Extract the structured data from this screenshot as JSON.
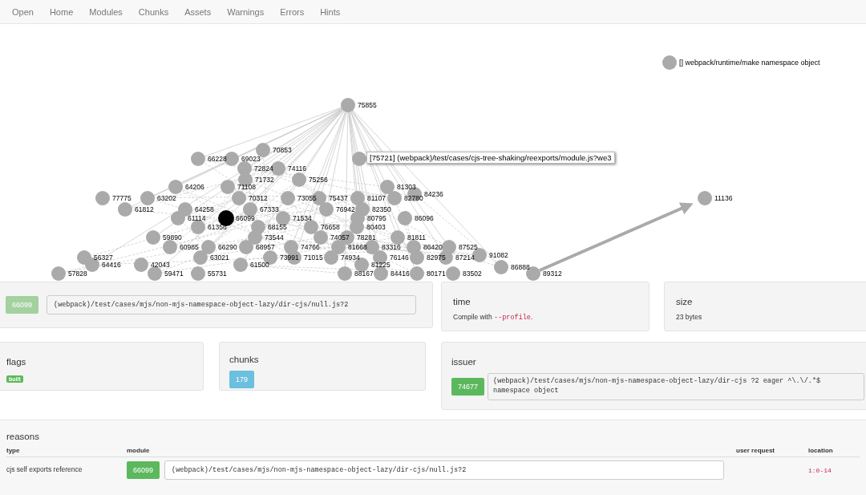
{
  "nav": [
    "Open",
    "Home",
    "Modules",
    "Chunks",
    "Assets",
    "Warnings",
    "Errors",
    "Hints"
  ],
  "graph": {
    "legend": "[] webpack/runtime/make namespace object",
    "tooltip": "[75721] (webpack)/test/cases/cjs-tree-shaking/reexports/module.js?we3",
    "nodes": [
      {
        "label": "75855",
        "selected": false
      },
      {
        "label": "70853",
        "selected": false
      },
      {
        "label": "66228",
        "selected": false
      },
      {
        "label": "69023",
        "selected": false
      },
      {
        "label": "72824",
        "selected": false
      },
      {
        "label": "74116",
        "selected": false
      },
      {
        "label": "71732",
        "selected": false
      },
      {
        "label": "75256",
        "selected": false
      },
      {
        "label": "64206",
        "selected": false
      },
      {
        "label": "71108",
        "selected": false
      },
      {
        "label": "81303",
        "selected": false
      },
      {
        "label": "77775",
        "selected": false
      },
      {
        "label": "63202",
        "selected": false
      },
      {
        "label": "70312",
        "selected": false
      },
      {
        "label": "73055",
        "selected": false
      },
      {
        "label": "75437",
        "selected": false
      },
      {
        "label": "81107",
        "selected": false
      },
      {
        "label": "82780",
        "selected": false
      },
      {
        "label": "84236",
        "selected": false
      },
      {
        "label": "11136",
        "selected": false
      },
      {
        "label": "61812",
        "selected": false
      },
      {
        "label": "64258",
        "selected": false
      },
      {
        "label": "67333",
        "selected": false
      },
      {
        "label": "76942",
        "selected": false
      },
      {
        "label": "82350",
        "selected": false
      },
      {
        "label": "61114",
        "selected": false
      },
      {
        "label": "66099",
        "selected": true
      },
      {
        "label": "71534",
        "selected": false
      },
      {
        "label": "80795",
        "selected": false
      },
      {
        "label": "86096",
        "selected": false
      },
      {
        "label": "61356",
        "selected": false
      },
      {
        "label": "68155",
        "selected": false
      },
      {
        "label": "76658",
        "selected": false
      },
      {
        "label": "80403",
        "selected": false
      },
      {
        "label": "59890",
        "selected": false
      },
      {
        "label": "73544",
        "selected": false
      },
      {
        "label": "74057",
        "selected": false
      },
      {
        "label": "78281",
        "selected": false
      },
      {
        "label": "81811",
        "selected": false
      },
      {
        "label": "60985",
        "selected": false
      },
      {
        "label": "66290",
        "selected": false
      },
      {
        "label": "68957",
        "selected": false
      },
      {
        "label": "74766",
        "selected": false
      },
      {
        "label": "81668",
        "selected": false
      },
      {
        "label": "83316",
        "selected": false
      },
      {
        "label": "86420",
        "selected": false
      },
      {
        "label": "87525",
        "selected": false
      },
      {
        "label": "56327",
        "selected": false
      },
      {
        "label": "63021",
        "selected": false
      },
      {
        "label": "73991",
        "selected": false
      },
      {
        "label": "71015",
        "selected": false
      },
      {
        "label": "74934",
        "selected": false
      },
      {
        "label": "76146",
        "selected": false
      },
      {
        "label": "82975",
        "selected": false
      },
      {
        "label": "87214",
        "selected": false
      },
      {
        "label": "91082",
        "selected": false
      },
      {
        "label": "64416",
        "selected": false
      },
      {
        "label": "42043",
        "selected": false
      },
      {
        "label": "61500",
        "selected": false
      },
      {
        "label": "81225",
        "selected": false
      },
      {
        "label": "86888",
        "selected": false
      },
      {
        "label": "57828",
        "selected": false
      },
      {
        "label": "59471",
        "selected": false
      },
      {
        "label": "55731",
        "selected": false
      },
      {
        "label": "88167",
        "selected": false
      },
      {
        "label": "84416",
        "selected": false
      },
      {
        "label": "80171",
        "selected": false
      },
      {
        "label": "83502",
        "selected": false
      },
      {
        "label": "89312",
        "selected": false
      }
    ]
  },
  "module_panel": {
    "id": "66099",
    "path": "(webpack)/test/cases/mjs/non-mjs-namespace-object-lazy/dir-cjs/null.js?2"
  },
  "time": {
    "title": "time",
    "note": "Compile with",
    "flag": "--profile",
    "note_end": "."
  },
  "size": {
    "title": "size",
    "value": "23 bytes"
  },
  "flags": {
    "title": "flags",
    "tags": [
      "built"
    ]
  },
  "chunks": {
    "title": "chunks",
    "ids": [
      "179"
    ]
  },
  "issuer": {
    "title": "issuer",
    "id": "74677",
    "path": "(webpack)/test/cases/mjs/non-mjs-namespace-object-lazy/dir-cjs ?2 eager ^\\.\\/.*$ namespace object"
  },
  "reasons": {
    "title": "reasons",
    "columns": [
      "type",
      "module",
      "user request",
      "location"
    ],
    "rows": [
      {
        "type": "cjs self exports reference",
        "module_id": "66099",
        "module": "(webpack)/test/cases/mjs/non-mjs-namespace-object-lazy/dir-cjs/null.js?2",
        "location": "1:0-14"
      }
    ]
  }
}
